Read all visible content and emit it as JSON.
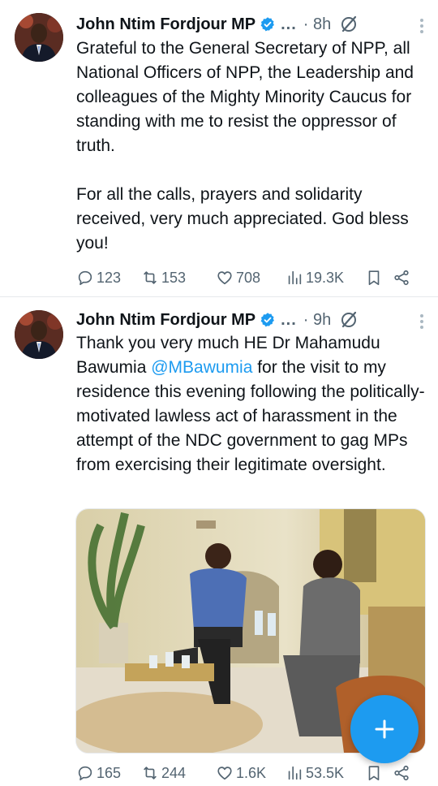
{
  "tweets": [
    {
      "author": "John Ntim Fordjour MP",
      "ellipsis": "...",
      "time": "· 8h",
      "paragraphs": [
        "Grateful to the General Secretary of NPP, all National Officers of NPP, the Leadership and colleagues of the Mighty Minority Caucus for standing with me to resist the oppressor of truth.",
        "For all the calls, prayers and solidarity received, very much appreciated. God bless you!"
      ],
      "stats": {
        "replies": "123",
        "reposts": "153",
        "likes": "708",
        "views": "19.3K"
      }
    },
    {
      "author": "John Ntim Fordjour MP",
      "ellipsis": "...",
      "time": "· 9h",
      "text_before": "Thank you very much HE Dr Mahamudu Bawumia ",
      "mention": "@MBawumia",
      "text_after": " for the visit to my residence this evening following the politically-motivated lawless act of harassment in the attempt of the NDC government to gag MPs from exercising their legitimate oversight.",
      "stats": {
        "replies": "165",
        "reposts": "244",
        "likes": "1.6K",
        "views": "53.5K"
      }
    }
  ],
  "icons": {
    "verified": "verified-badge-icon",
    "grok": "grok-icon",
    "more": "more-options-icon",
    "reply": "reply-icon",
    "repost": "repost-icon",
    "like": "heart-icon",
    "views": "views-icon",
    "bookmark": "bookmark-icon",
    "share": "share-icon",
    "compose": "plus-icon"
  },
  "colors": {
    "accent": "#1d9bf0",
    "text": "#0f1419",
    "muted": "#536471"
  }
}
